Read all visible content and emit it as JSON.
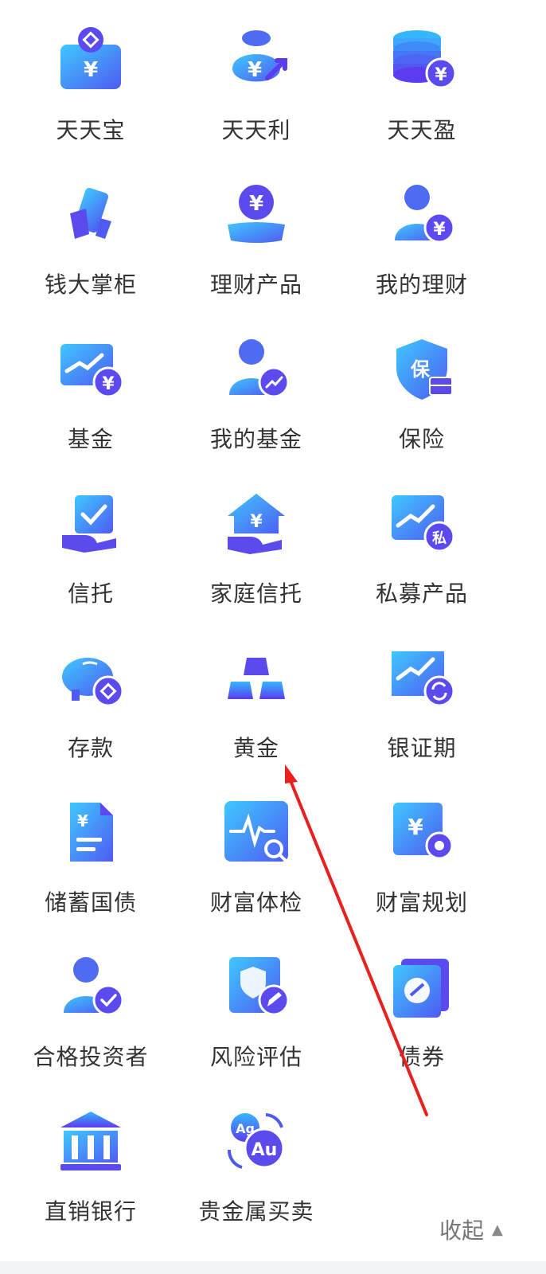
{
  "colors": {
    "icon_gradient_start": "#35B7FF",
    "icon_gradient_end": "#5B3CF0",
    "accent_purple": "#5B4BEF",
    "label_text": "#333333",
    "annotation_arrow": "#E8201E"
  },
  "items": [
    {
      "label": "天天宝",
      "icon": "safe-box-yuan-icon"
    },
    {
      "label": "天天利",
      "icon": "money-bag-icon"
    },
    {
      "label": "天天盈",
      "icon": "coin-stack-yuan-icon"
    },
    {
      "label": "钱大掌柜",
      "icon": "card-in-hand-icon"
    },
    {
      "label": "理财产品",
      "icon": "yuan-in-hand-icon"
    },
    {
      "label": "我的理财",
      "icon": "user-yuan-icon"
    },
    {
      "label": "基金",
      "icon": "trend-chart-yuan-icon"
    },
    {
      "label": "我的基金",
      "icon": "user-trend-icon"
    },
    {
      "label": "保险",
      "icon": "shield-bao-icon"
    },
    {
      "label": "信托",
      "icon": "check-in-hand-icon"
    },
    {
      "label": "家庭信托",
      "icon": "house-yuan-hand-icon"
    },
    {
      "label": "私募产品",
      "icon": "trend-private-icon"
    },
    {
      "label": "存款",
      "icon": "piggy-bank-icon"
    },
    {
      "label": "黄金",
      "icon": "gold-bars-icon"
    },
    {
      "label": "银证期",
      "icon": "trend-exchange-icon"
    },
    {
      "label": "储蓄国债",
      "icon": "bond-document-icon"
    },
    {
      "label": "财富体检",
      "icon": "health-check-icon"
    },
    {
      "label": "财富规划",
      "icon": "yuan-gear-icon"
    },
    {
      "label": "合格投资者",
      "icon": "user-check-icon"
    },
    {
      "label": "风险评估",
      "icon": "shield-pen-icon"
    },
    {
      "label": "债券",
      "icon": "bond-card-icon"
    },
    {
      "label": "直销银行",
      "icon": "bank-building-icon"
    },
    {
      "label": "贵金属买卖",
      "icon": "ag-au-exchange-icon"
    }
  ],
  "footer": {
    "collapse_label": "收起",
    "collapse_icon": "caret-up-icon"
  }
}
